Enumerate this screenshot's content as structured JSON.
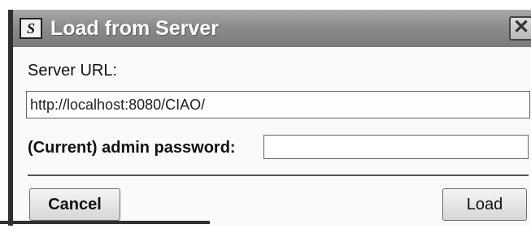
{
  "window": {
    "title": "Load from Server",
    "icon": "app-icon",
    "icon_text": "S",
    "close_glyph": "✕"
  },
  "form": {
    "url_label": "Server URL:",
    "url_value": "http://localhost:8080/CIAO/",
    "password_label": "(Current) admin password:",
    "password_value": ""
  },
  "buttons": {
    "cancel_label": "Cancel",
    "load_label": "Load"
  },
  "colors": {
    "titlebar": "#8c8c8c",
    "title_text": "#ffffff"
  }
}
